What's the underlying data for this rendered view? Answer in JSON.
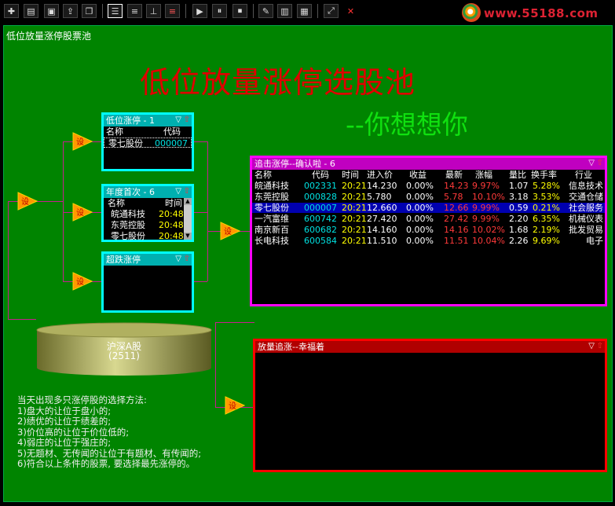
{
  "toolbar": {
    "buttons": [
      "new-icon",
      "open-icon",
      "save-icon",
      "export-icon",
      "window-icon",
      "layout-h-icon",
      "align-left-icon",
      "align-bottom-icon",
      "color-bars-icon",
      "play-icon",
      "pause-icon",
      "stop-icon",
      "edit-icon",
      "delete-doc-icon",
      "properties-icon",
      "fullscreen-icon",
      "close-icon"
    ]
  },
  "logo": {
    "text": "www.55188.com"
  },
  "panel_title": "低位放量涨停股票池",
  "title": "低位放量涨停选股池",
  "subtitle": "--你想想你",
  "trigger_label": "设",
  "win1": {
    "title": "低位涨停 - 1",
    "headers": [
      "名称",
      "代码"
    ],
    "rows": [
      {
        "name": "零七股份",
        "code": "000007"
      }
    ]
  },
  "win2": {
    "title": "年度首次 - 6",
    "headers": [
      "名称",
      "时间"
    ],
    "rows": [
      {
        "name": "皖通科技",
        "time": "20:48"
      },
      {
        "name": "东莞控股",
        "time": "20:48"
      },
      {
        "name": "零七股份",
        "time": "20:48"
      }
    ]
  },
  "win3": {
    "title": "超跌涨停"
  },
  "win4": {
    "title": "追击涨停--确认啦 - 6",
    "headers": [
      "名称",
      "代码",
      "时间",
      "进入价",
      "收益",
      "最新",
      "涨幅",
      "量比",
      "换手率",
      "行业"
    ],
    "rows": [
      {
        "name": "皖通科技",
        "code": "002331",
        "time": "20:21",
        "entry": "14.230",
        "gain": "0.00%",
        "last": "14.23",
        "chg": "9.97%",
        "vol": "1.07",
        "turn": "5.28%",
        "ind": "信息技术"
      },
      {
        "name": "东莞控股",
        "code": "000828",
        "time": "20:21",
        "entry": "5.780",
        "gain": "0.00%",
        "last": "5.78",
        "chg": "10.10%",
        "vol": "3.18",
        "turn": "3.53%",
        "ind": "交通仓储"
      },
      {
        "name": "零七股份",
        "code": "000007",
        "time": "20:21",
        "entry": "12.660",
        "gain": "0.00%",
        "last": "12.66",
        "chg": "9.99%",
        "vol": "0.59",
        "turn": "0.21%",
        "ind": "社会服务"
      },
      {
        "name": "一汽富维",
        "code": "600742",
        "time": "20:21",
        "entry": "27.420",
        "gain": "0.00%",
        "last": "27.42",
        "chg": "9.99%",
        "vol": "2.20",
        "turn": "6.35%",
        "ind": "机械仪表"
      },
      {
        "name": "南京新百",
        "code": "600682",
        "time": "20:21",
        "entry": "14.160",
        "gain": "0.00%",
        "last": "14.16",
        "chg": "10.02%",
        "vol": "1.68",
        "turn": "2.19%",
        "ind": "批发贸易"
      },
      {
        "name": "长电科技",
        "code": "600584",
        "time": "20:21",
        "entry": "11.510",
        "gain": "0.00%",
        "last": "11.51",
        "chg": "10.04%",
        "vol": "2.26",
        "turn": "9.69%",
        "ind": "电子"
      }
    ]
  },
  "win5": {
    "title": "放量追涨--幸福着"
  },
  "pool": {
    "name": "沪深A股",
    "count": "(2511)"
  },
  "rules": [
    "当天出现多只涨停股的选择方法:",
    "1)盘大的让位于盘小的;",
    "2)绩优的让位于绩差的;",
    "3)价位高的让位于价位低的;",
    "4)弱庄的让位于强庄的;",
    "5)无题材、无传闻的让位于有题材、有传闻的;",
    "6)符合以上条件的股票, 要选择最先涨停的。"
  ]
}
